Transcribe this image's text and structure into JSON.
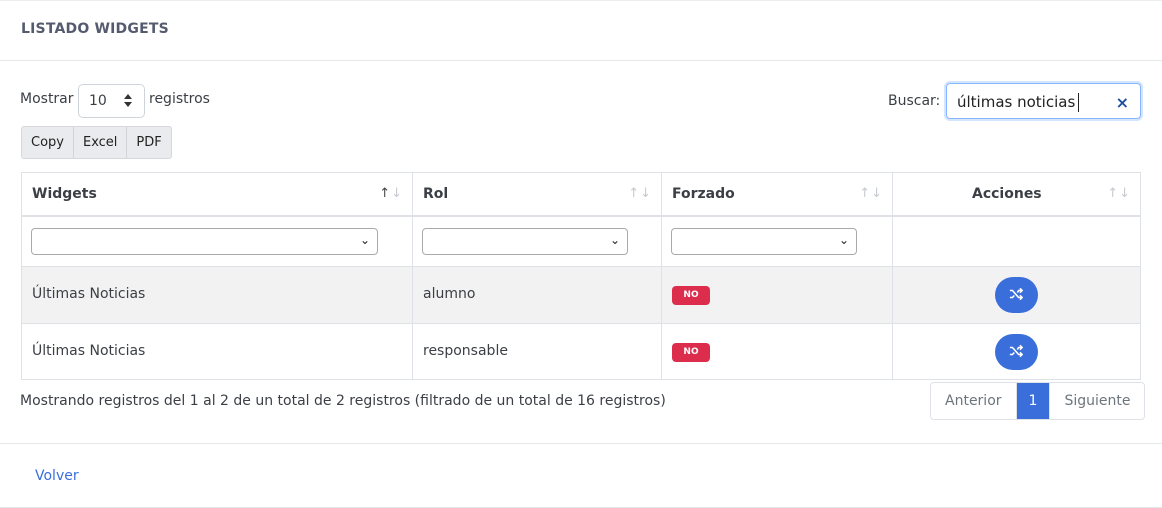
{
  "card": {
    "title": "LISTADO WIDGETS"
  },
  "length": {
    "prefix": "Mostrar",
    "value": "10",
    "suffix": "registros"
  },
  "buttons": {
    "copy": "Copy",
    "excel": "Excel",
    "pdf": "PDF"
  },
  "search": {
    "label": "Buscar:",
    "value": "últimas noticias",
    "clear": "×"
  },
  "table": {
    "headers": [
      "Widgets",
      "Rol",
      "Forzado",
      "Acciones"
    ],
    "rows": [
      {
        "widget": "Últimas Noticias",
        "rol": "alumno",
        "forzado": "NO"
      },
      {
        "widget": "Últimas Noticias",
        "rol": "responsable",
        "forzado": "NO"
      }
    ]
  },
  "info": "Mostrando registros del 1 al 2 de un total de 2 registros (filtrado de un total de 16 registros)",
  "pagination": {
    "prev": "Anterior",
    "current": "1",
    "next": "Siguiente"
  },
  "footer": {
    "back": "Volver"
  },
  "icons": {
    "sort": "sort-arrows-icon",
    "action": "shuffle-icon",
    "clear": "close-icon",
    "select": "chevron-down-icon"
  },
  "colors": {
    "primary": "#3a6edb",
    "danger": "#dc2d4d",
    "striped": "#f2f2f2"
  }
}
